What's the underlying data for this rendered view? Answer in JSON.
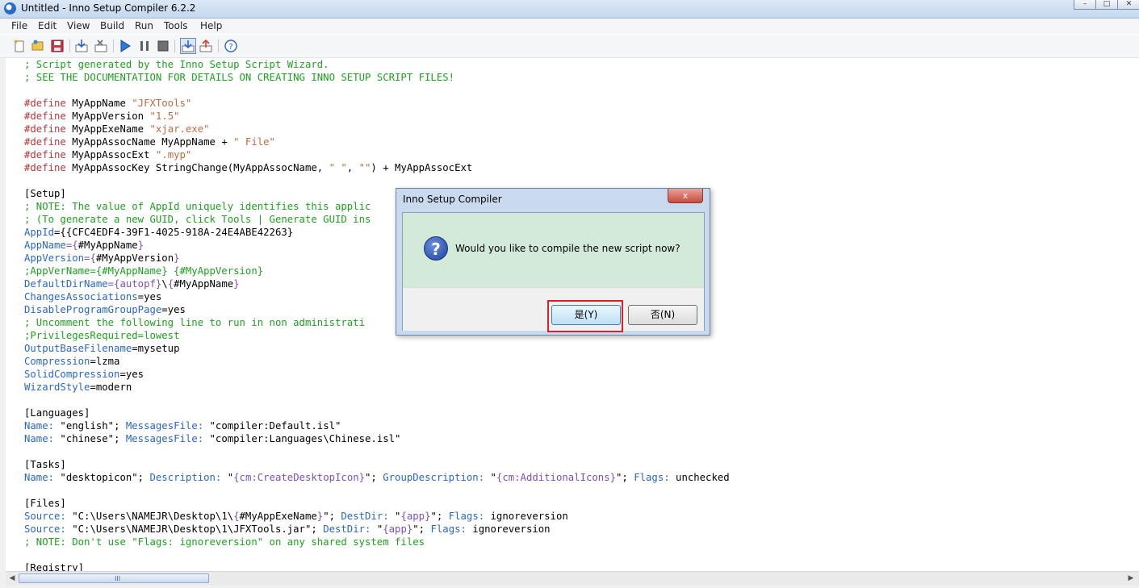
{
  "window": {
    "title": "Untitled - Inno Setup Compiler 6.2.2"
  },
  "menu": [
    "File",
    "Edit",
    "View",
    "Build",
    "Run",
    "Tools",
    "Help"
  ],
  "toolbar": [
    "new-file-icon",
    "open-folder-icon",
    "save-icon",
    "compile-icon",
    "stop-compile-icon",
    "run-icon",
    "pause-icon",
    "stop-icon",
    "target-icon",
    "upload-icon",
    "help-icon"
  ],
  "code": [
    [
      {
        "t": "; Script generated by the Inno Setup Script Wizard.",
        "c": "c-cmt"
      }
    ],
    [
      {
        "t": "; SEE THE DOCUMENTATION FOR DETAILS ON CREATING INNO SETUP SCRIPT FILES!",
        "c": "c-cmt"
      }
    ],
    [],
    [
      {
        "t": "#define",
        "c": "c-dir"
      },
      {
        "t": " MyAppName "
      },
      {
        "t": "\"JFXTools\"",
        "c": "c-str"
      }
    ],
    [
      {
        "t": "#define",
        "c": "c-dir"
      },
      {
        "t": " MyAppVersion "
      },
      {
        "t": "\"1.5\"",
        "c": "c-str"
      }
    ],
    [
      {
        "t": "#define",
        "c": "c-dir"
      },
      {
        "t": " MyAppExeName "
      },
      {
        "t": "\"xjar.exe\"",
        "c": "c-str"
      }
    ],
    [
      {
        "t": "#define",
        "c": "c-dir"
      },
      {
        "t": " MyAppAssocName MyAppName + "
      },
      {
        "t": "\" File\"",
        "c": "c-str"
      }
    ],
    [
      {
        "t": "#define",
        "c": "c-dir"
      },
      {
        "t": " MyAppAssocExt "
      },
      {
        "t": "\".myp\"",
        "c": "c-str"
      }
    ],
    [
      {
        "t": "#define",
        "c": "c-dir"
      },
      {
        "t": " MyAppAssocKey StringChange(MyAppAssocName, "
      },
      {
        "t": "\" \"",
        "c": "c-str"
      },
      {
        "t": ", "
      },
      {
        "t": "\"\"",
        "c": "c-str"
      },
      {
        "t": ") + MyAppAssocExt"
      }
    ],
    [],
    [
      {
        "t": "[Setup]"
      }
    ],
    [
      {
        "t": "; NOTE: The value of AppId uniquely identifies this applic                         ers for other applications.",
        "c": "c-cmt"
      }
    ],
    [
      {
        "t": "; (To generate a new GUID, click Tools | Generate GUID ins",
        "c": "c-cmt"
      }
    ],
    [
      {
        "t": "AppId",
        "c": "c-key"
      },
      {
        "t": "={{CFC4EDF4-39F1-4025-918A-24E4ABE42263}"
      }
    ],
    [
      {
        "t": "AppName",
        "c": "c-key"
      },
      {
        "t": "={",
        "c": "c-cnst"
      },
      {
        "t": "#MyAppName"
      },
      {
        "t": "}",
        "c": "c-cnst"
      }
    ],
    [
      {
        "t": "AppVersion",
        "c": "c-key"
      },
      {
        "t": "={",
        "c": "c-cnst"
      },
      {
        "t": "#MyAppVersion"
      },
      {
        "t": "}",
        "c": "c-cnst"
      }
    ],
    [
      {
        "t": ";AppVerName={#MyAppName} {#MyAppVersion}",
        "c": "c-cmt"
      }
    ],
    [
      {
        "t": "DefaultDirName",
        "c": "c-key"
      },
      {
        "t": "={autopf}",
        "c": "c-cnst"
      },
      {
        "t": "\\"
      },
      {
        "t": "{",
        "c": "c-cnst"
      },
      {
        "t": "#MyAppName"
      },
      {
        "t": "}",
        "c": "c-cnst"
      }
    ],
    [
      {
        "t": "ChangesAssociations",
        "c": "c-key"
      },
      {
        "t": "=yes"
      }
    ],
    [
      {
        "t": "DisableProgramGroupPage",
        "c": "c-key"
      },
      {
        "t": "=yes"
      }
    ],
    [
      {
        "t": "; Uncomment the following line to run in non administrati",
        "c": "c-cmt"
      }
    ],
    [
      {
        "t": ";PrivilegesRequired=lowest",
        "c": "c-cmt"
      }
    ],
    [
      {
        "t": "OutputBaseFilename",
        "c": "c-key"
      },
      {
        "t": "=mysetup"
      }
    ],
    [
      {
        "t": "Compression",
        "c": "c-key"
      },
      {
        "t": "=lzma"
      }
    ],
    [
      {
        "t": "SolidCompression",
        "c": "c-key"
      },
      {
        "t": "=yes"
      }
    ],
    [
      {
        "t": "WizardStyle",
        "c": "c-key"
      },
      {
        "t": "=modern"
      }
    ],
    [],
    [
      {
        "t": "[Languages]"
      }
    ],
    [
      {
        "t": "Name:",
        "c": "c-key"
      },
      {
        "t": " \"english\"; "
      },
      {
        "t": "MessagesFile:",
        "c": "c-key"
      },
      {
        "t": " \"compiler:Default.isl\""
      }
    ],
    [
      {
        "t": "Name:",
        "c": "c-key"
      },
      {
        "t": " \"chinese\"; "
      },
      {
        "t": "MessagesFile:",
        "c": "c-key"
      },
      {
        "t": " \"compiler:Languages\\Chinese.isl\""
      }
    ],
    [],
    [
      {
        "t": "[Tasks]"
      }
    ],
    [
      {
        "t": "Name:",
        "c": "c-key"
      },
      {
        "t": " \"desktopicon\"; "
      },
      {
        "t": "Description:",
        "c": "c-key"
      },
      {
        "t": " \""
      },
      {
        "t": "{cm:CreateDesktopIcon}",
        "c": "c-cnst"
      },
      {
        "t": "\"; "
      },
      {
        "t": "GroupDescription:",
        "c": "c-key"
      },
      {
        "t": " \""
      },
      {
        "t": "{cm:AdditionalIcons}",
        "c": "c-cnst"
      },
      {
        "t": "\"; "
      },
      {
        "t": "Flags:",
        "c": "c-key"
      },
      {
        "t": " unchecked"
      }
    ],
    [],
    [
      {
        "t": "[Files]"
      }
    ],
    [
      {
        "t": "Source:",
        "c": "c-key"
      },
      {
        "t": " \"C:\\Users\\NAMEJR\\Desktop\\1\\"
      },
      {
        "t": "{",
        "c": "c-cnst"
      },
      {
        "t": "#MyAppExeName"
      },
      {
        "t": "}",
        "c": "c-cnst"
      },
      {
        "t": "\"; "
      },
      {
        "t": "DestDir:",
        "c": "c-key"
      },
      {
        "t": " \""
      },
      {
        "t": "{app}",
        "c": "c-cnst"
      },
      {
        "t": "\"; "
      },
      {
        "t": "Flags:",
        "c": "c-key"
      },
      {
        "t": " ignoreversion"
      }
    ],
    [
      {
        "t": "Source:",
        "c": "c-key"
      },
      {
        "t": " \"C:\\Users\\NAMEJR\\Desktop\\1\\JFXTools.jar\"; "
      },
      {
        "t": "DestDir:",
        "c": "c-key"
      },
      {
        "t": " \""
      },
      {
        "t": "{app}",
        "c": "c-cnst"
      },
      {
        "t": "\"; "
      },
      {
        "t": "Flags:",
        "c": "c-key"
      },
      {
        "t": " ignoreversion"
      }
    ],
    [
      {
        "t": "; NOTE: Don't use \"Flags: ignoreversion\" on any shared system files",
        "c": "c-cmt"
      }
    ],
    [],
    [
      {
        "t": "[Registry]"
      }
    ]
  ],
  "dialog": {
    "title": "Inno Setup Compiler",
    "close": "x",
    "message": "Would you like to compile the new script now?",
    "icon": "question-icon",
    "yes_label": "是(Y)",
    "no_label": "否(N)"
  },
  "scrollbar": {
    "grip": "III"
  }
}
